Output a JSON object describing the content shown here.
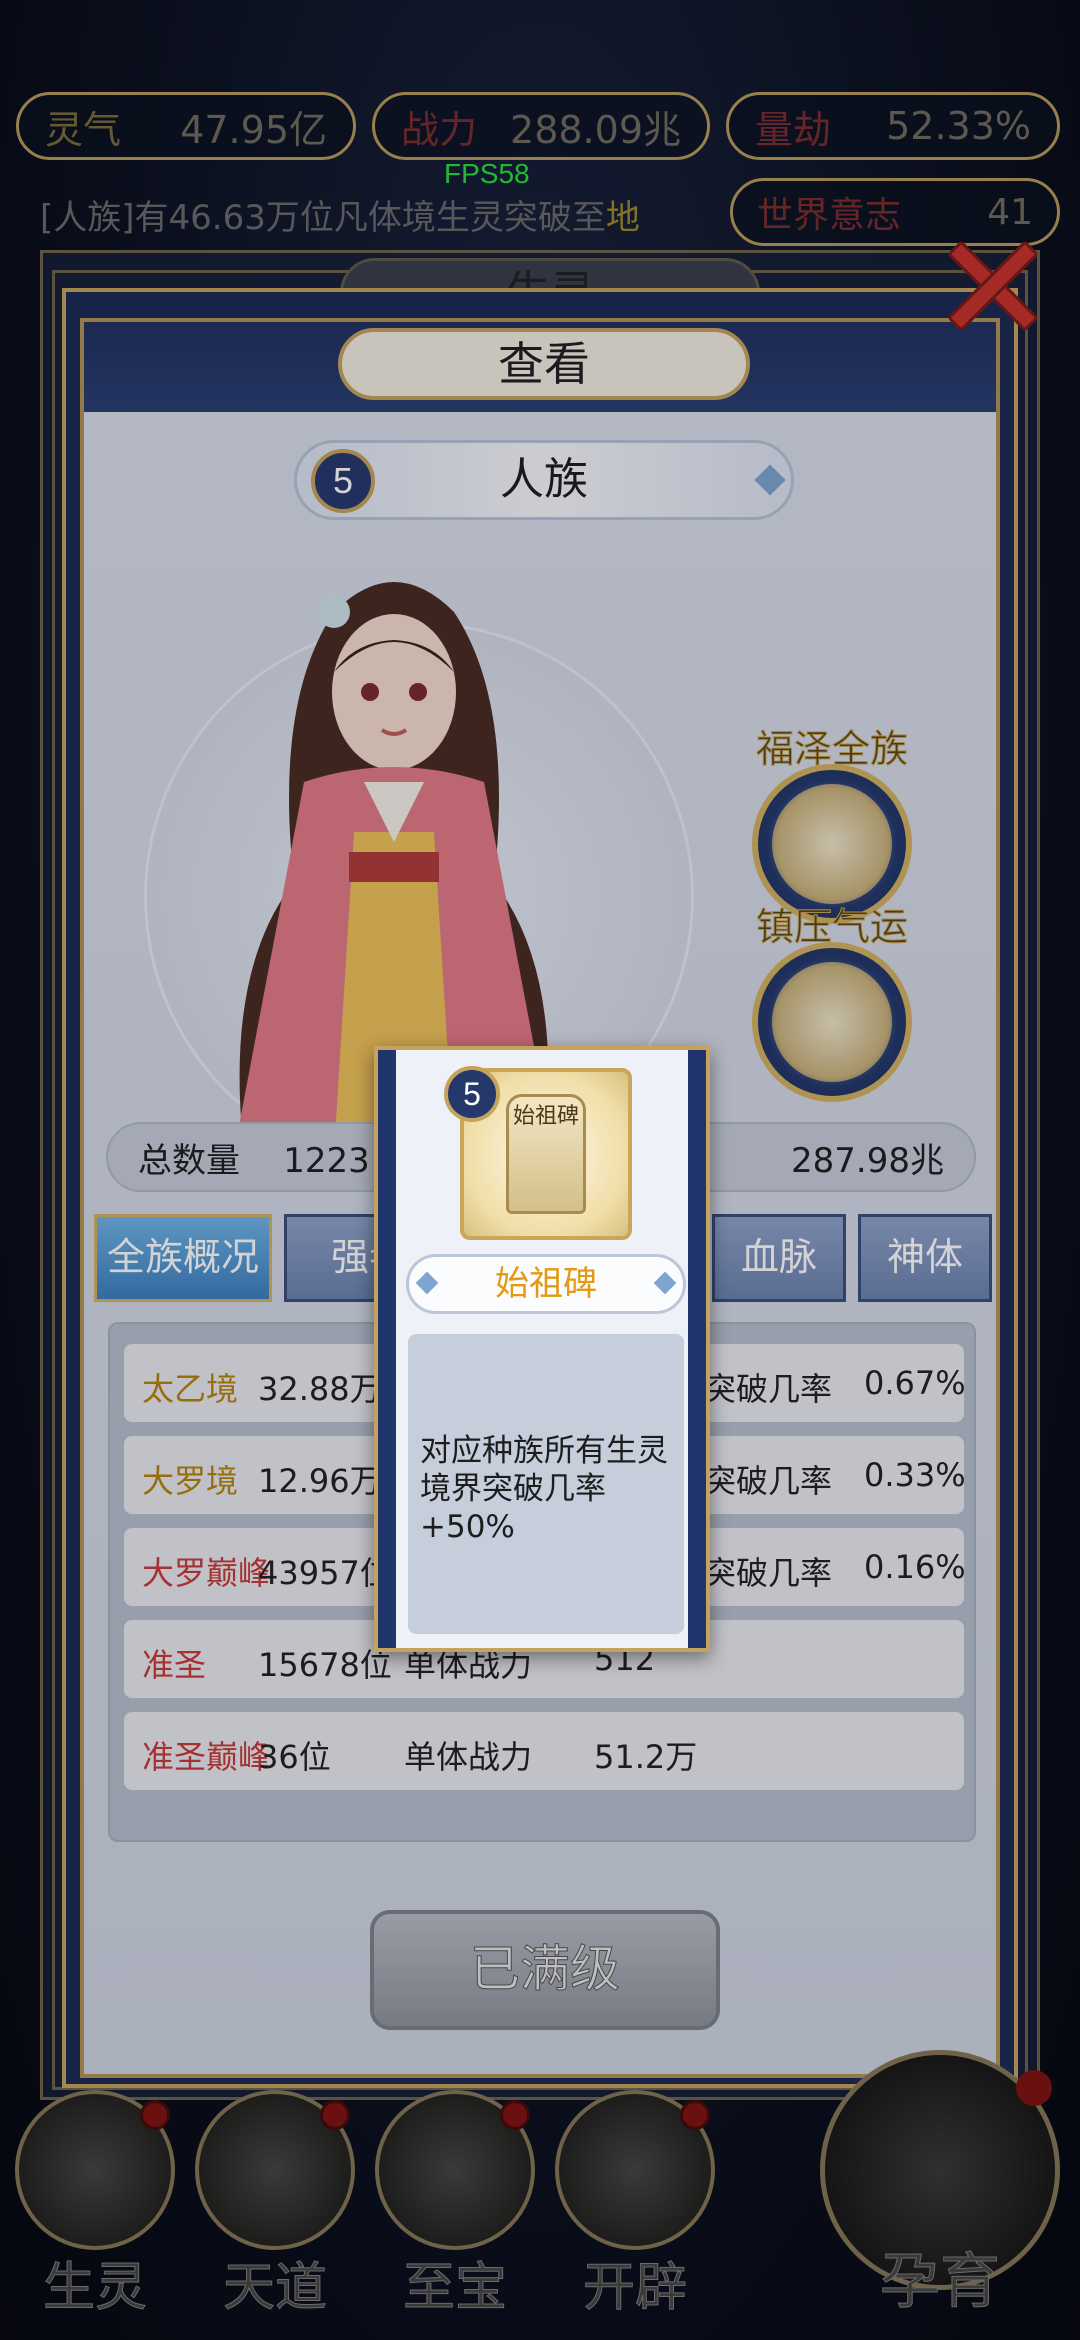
{
  "resources": {
    "spirit": {
      "label": "灵气",
      "value": "47.95亿"
    },
    "power": {
      "label": "战力",
      "value": "288.09兆"
    },
    "calamity": {
      "label": "量劫",
      "value": "52.33%"
    }
  },
  "fps": "FPS58",
  "news_ticker": {
    "prefix": "[人族]有46.63万位凡体境生灵突破至",
    "highlight": "地"
  },
  "world_will": {
    "label": "世界意志",
    "value": "41"
  },
  "background_panel_title": "生灵",
  "panel": {
    "title": "查看",
    "race": {
      "level": "5",
      "name": "人族"
    },
    "blessing": {
      "label": "福泽全族"
    },
    "suppress": {
      "label": "镇压气运"
    },
    "stats": {
      "total_label": "总数量",
      "total_value": "1223",
      "power_value": "287.98兆"
    },
    "tabs": [
      {
        "label": "全族概况",
        "active": true
      },
      {
        "label": "强者",
        "active": false
      },
      {
        "label": "血脉",
        "active": false
      },
      {
        "label": "神体",
        "active": false
      }
    ],
    "realm_rows": [
      {
        "realm": "太乙境",
        "count": "32.88万位",
        "rate_label": "突破几率",
        "rate": "0.67%",
        "color": "gold"
      },
      {
        "realm": "大罗境",
        "count": "12.96万位",
        "rate_label": "突破几率",
        "rate": "0.33%",
        "color": "gold"
      },
      {
        "realm": "大罗巅峰",
        "count": "43957位",
        "rate_label": "突破几率",
        "rate": "0.16%",
        "color": "red"
      },
      {
        "realm": "准圣",
        "count": "15678位",
        "attr": "单体战力",
        "value": "512",
        "color": "red"
      },
      {
        "realm": "准圣巅峰",
        "count": "36位",
        "attr": "单体战力",
        "value": "51.2万",
        "color": "red"
      }
    ],
    "maxed_button": "已满级"
  },
  "popup": {
    "level": "5",
    "icon_text": "始祖碑",
    "name": "始祖碑",
    "description": "对应种族所有生灵境界突破几率+50%"
  },
  "bottom_nav": [
    {
      "label": "生灵",
      "badge": true
    },
    {
      "label": "天道",
      "badge": true
    },
    {
      "label": "至宝",
      "badge": true
    },
    {
      "label": "开辟",
      "badge": true
    }
  ],
  "nurture": {
    "label": "孕育",
    "badge": true
  },
  "colors": {
    "gold_text": "#b8830a",
    "red_text": "#c73a3a",
    "accent_blue": "#3d7fbe",
    "frame_gold": "#c5a35c"
  }
}
